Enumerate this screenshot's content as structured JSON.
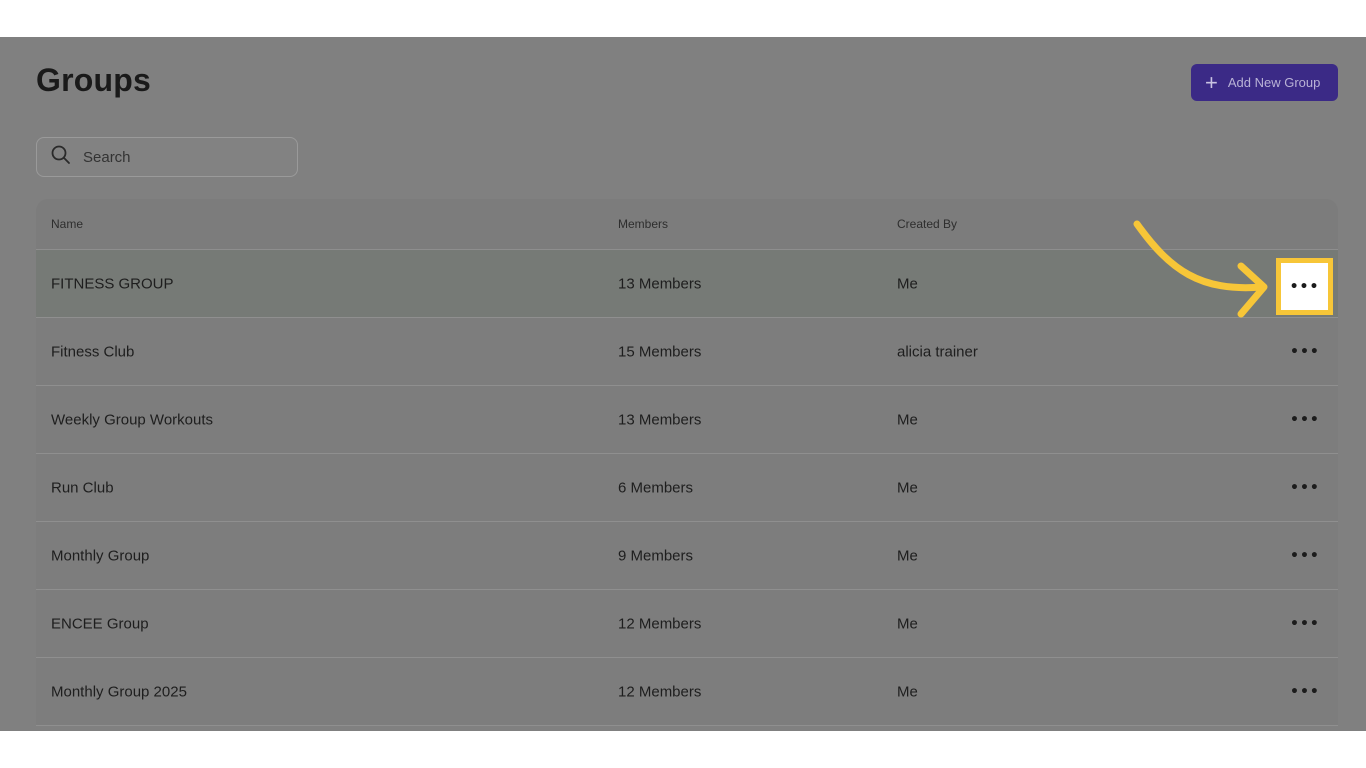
{
  "page": {
    "title": "Groups"
  },
  "toolbar": {
    "add_label": "Add New Group"
  },
  "search": {
    "placeholder": "Search"
  },
  "table": {
    "columns": [
      "Name",
      "Members",
      "Created By"
    ],
    "rows": [
      {
        "name": "FITNESS GROUP",
        "members": "13 Members",
        "created_by": "Me"
      },
      {
        "name": "Fitness Club",
        "members": "15 Members",
        "created_by": "alicia trainer"
      },
      {
        "name": "Weekly Group Workouts",
        "members": "13 Members",
        "created_by": "Me"
      },
      {
        "name": "Run Club",
        "members": "6 Members",
        "created_by": "Me"
      },
      {
        "name": "Monthly Group",
        "members": "9 Members",
        "created_by": "Me"
      },
      {
        "name": "ENCEE Group",
        "members": "12 Members",
        "created_by": "Me"
      },
      {
        "name": "Monthly Group 2025",
        "members": "12 Members",
        "created_by": "Me"
      }
    ],
    "row_menu_label": "•••"
  },
  "icons": {
    "add": "plus-icon",
    "search": "search-icon",
    "row_menu": "more-horizontal-icon",
    "callout": "arrow-annotation"
  },
  "colors": {
    "accent": "#3b2a86",
    "highlight": "#f7c638",
    "overlay": "#808080"
  }
}
